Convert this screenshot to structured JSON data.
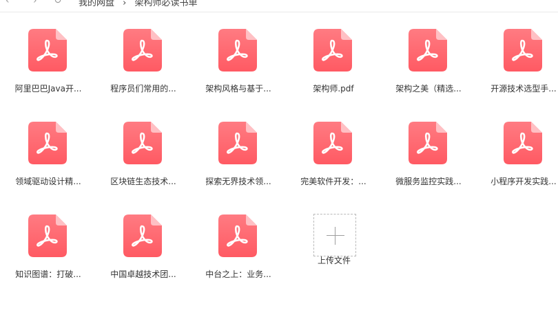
{
  "toolbar": {
    "back_icon": "chevron-left-icon",
    "forward_icon": "chevron-right-icon",
    "refresh_icon": "refresh-icon",
    "breadcrumb": [
      "我的网盘",
      "›",
      "架构师必读书单"
    ]
  },
  "files": [
    {
      "label": "阿里巴巴Java开...",
      "icon": "pdf-icon"
    },
    {
      "label": "程序员们常用的...",
      "icon": "pdf-icon"
    },
    {
      "label": "架构风格与基于...",
      "icon": "pdf-icon"
    },
    {
      "label": "架构师.pdf",
      "icon": "pdf-icon"
    },
    {
      "label": "架构之美（精选...",
      "icon": "pdf-icon"
    },
    {
      "label": "开源技术选型手...",
      "icon": "pdf-icon"
    },
    {
      "label": "领域驱动设计精...",
      "icon": "pdf-icon"
    },
    {
      "label": "区块链生态技术...",
      "icon": "pdf-icon"
    },
    {
      "label": "探索无界技术领...",
      "icon": "pdf-icon"
    },
    {
      "label": "完美软件开发：...",
      "icon": "pdf-icon"
    },
    {
      "label": "微服务监控实践...",
      "icon": "pdf-icon"
    },
    {
      "label": "小程序开发实践...",
      "icon": "pdf-icon"
    },
    {
      "label": "知识图谱：打破...",
      "icon": "pdf-icon"
    },
    {
      "label": "中国卓越技术团...",
      "icon": "pdf-icon"
    },
    {
      "label": "中台之上：业务...",
      "icon": "pdf-icon"
    }
  ],
  "upload": {
    "label": "上传文件",
    "icon": "plus-icon"
  },
  "colors": {
    "pdf_top": "#ff7b82",
    "pdf_bottom": "#ff5a63",
    "pdf_fold": "#ffc0c4",
    "pdf_symbol": "#ffffff"
  }
}
